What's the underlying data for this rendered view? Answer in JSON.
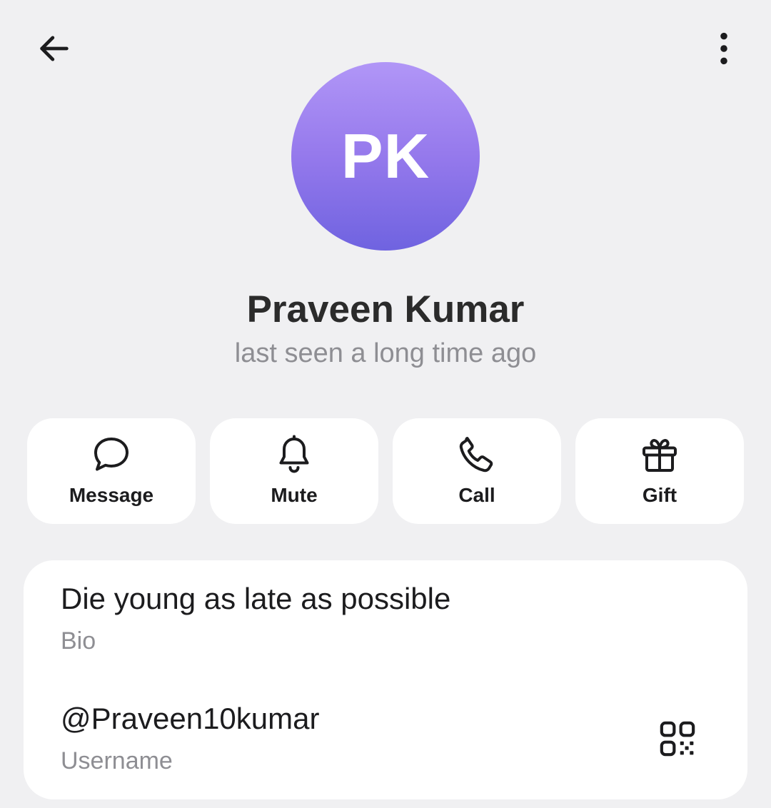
{
  "topbar": {
    "back_icon": "arrow-left-icon",
    "menu_icon": "more-vertical-icon"
  },
  "profile": {
    "initials": "PK",
    "avatar_gradient": [
      "#b196f7",
      "#6f63e0"
    ],
    "name": "Praveen Kumar",
    "status": "last seen a long time ago"
  },
  "actions": [
    {
      "label": "Message",
      "icon": "chat-bubble-icon"
    },
    {
      "label": "Mute",
      "icon": "bell-icon"
    },
    {
      "label": "Call",
      "icon": "phone-icon"
    },
    {
      "label": "Gift",
      "icon": "gift-icon"
    }
  ],
  "info": {
    "bio": {
      "value": "Die young as late as possible",
      "label": "Bio"
    },
    "username": {
      "value": "@Praveen10kumar",
      "label": "Username",
      "action_icon": "qr-code-icon"
    }
  }
}
